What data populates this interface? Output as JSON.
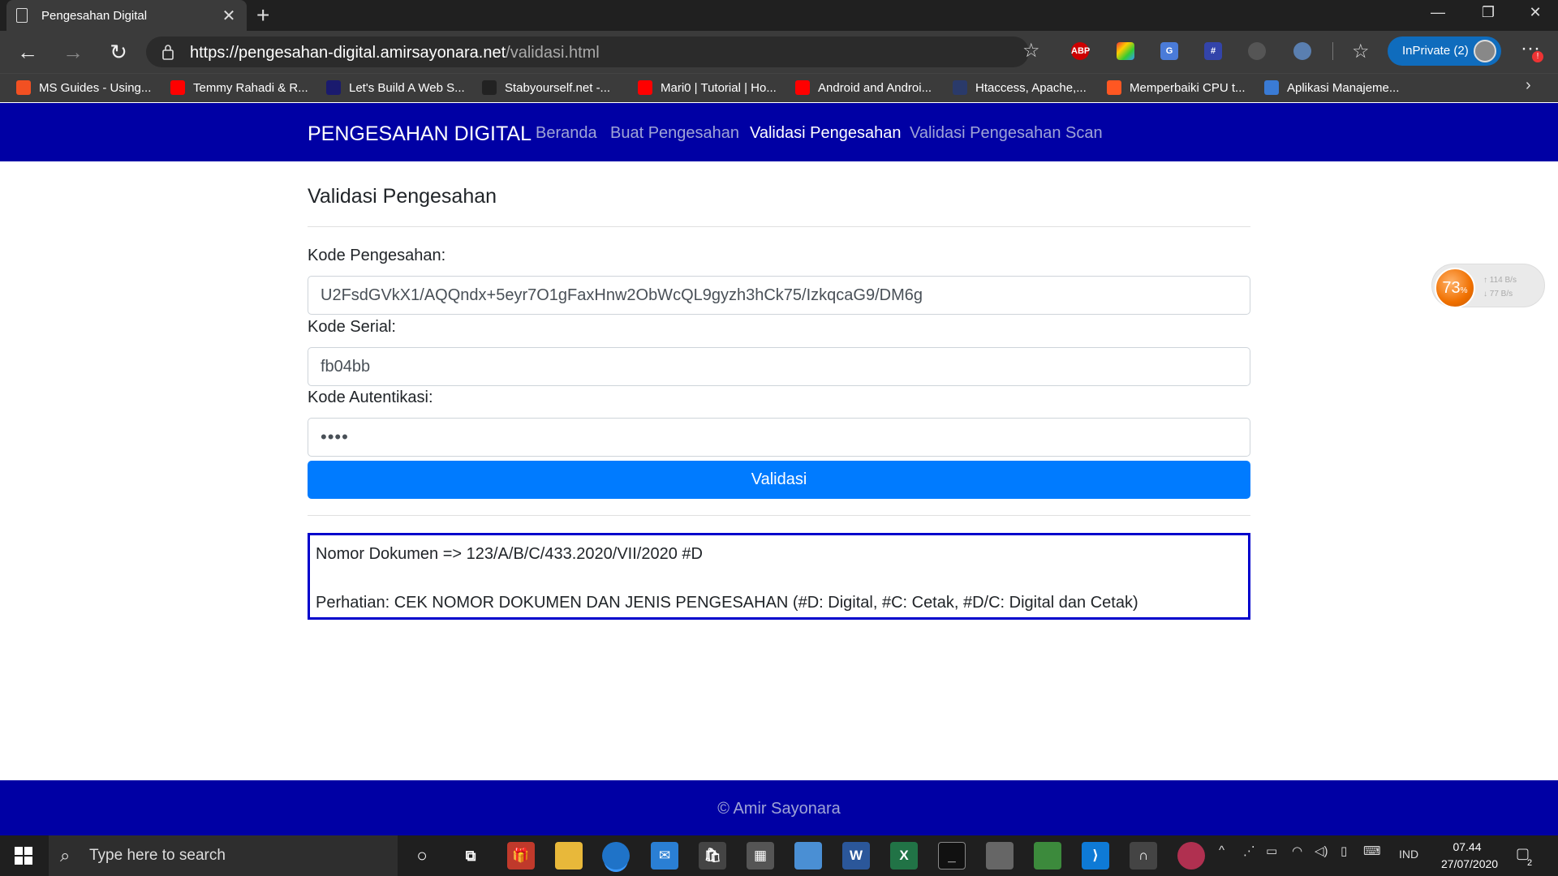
{
  "browser": {
    "tab_title": "Pengesahan Digital",
    "url_host": "https://pengesahan-digital.amirsayonara.net",
    "url_path": "/validasi.html",
    "inprivate_label": "InPrivate (2)",
    "extensions": [
      "abp-icon",
      "colorful-extension-icon",
      "google-translate-icon",
      "tech-extension-icon",
      "bot-icon",
      "globe-icon"
    ]
  },
  "bookmarks": [
    {
      "label": "MS Guides - Using...",
      "icon": "microsoft-icon",
      "color": "#f25022"
    },
    {
      "label": "Temmy Rahadi & R...",
      "icon": "youtube-icon",
      "color": "#ff0000"
    },
    {
      "label": "Let's Build A Web S...",
      "icon": "rs-icon",
      "color": "#1a1a6e"
    },
    {
      "label": "Stabyourself.net -...",
      "icon": "m-icon",
      "color": "#222222"
    },
    {
      "label": "Mari0 | Tutorial | Ho...",
      "icon": "youtube-icon",
      "color": "#ff0000"
    },
    {
      "label": "Android and Androi...",
      "icon": "youtube-icon",
      "color": "#ff0000"
    },
    {
      "label": "Htaccess, Apache,...",
      "icon": "site-icon",
      "color": "#2a3a6a"
    },
    {
      "label": "Memperbaiki CPU t...",
      "icon": "blogger-icon",
      "color": "#ff5722"
    },
    {
      "label": "Aplikasi Manajeme...",
      "icon": "app-icon",
      "color": "#3a7bd5"
    }
  ],
  "site": {
    "brand": "PENGESAHAN DIGITAL",
    "nav": [
      "Beranda",
      "Buat Pengesahan",
      "Validasi Pengesahan",
      "Validasi Pengesahan Scan"
    ],
    "active_nav": "Validasi Pengesahan",
    "heading": "Validasi Pengesahan",
    "fields": {
      "kode_pengesahan_label": "Kode Pengesahan:",
      "kode_pengesahan_value": "U2FsdGVkX1/AQQndx+5eyr7O1gFaxHnw2ObWcQL9gyzh3hCk75/IzkqcaG9/DM6g",
      "kode_serial_label": "Kode Serial:",
      "kode_serial_value": "fb04bb",
      "kode_autentikasi_label": "Kode Autentikasi:",
      "kode_autentikasi_value": "••••"
    },
    "submit_label": "Validasi",
    "result": {
      "line1": "Nomor Dokumen => 123/A/B/C/433.2020/VII/2020 #D",
      "line2": "Perhatian: CEK NOMOR DOKUMEN DAN JENIS PENGESAHAN (#D: Digital, #C: Cetak, #D/C: Digital dan Cetak)"
    },
    "footer": "© Amir Sayonara"
  },
  "widget": {
    "percent": "73",
    "percent_unit": "%",
    "up": "114 B/s",
    "down": "77 B/s"
  },
  "taskbar": {
    "search_placeholder": "Type here to search",
    "language": "IND",
    "time": "07.44",
    "date": "27/07/2020",
    "notification_count": "2"
  },
  "colors": {
    "navbar": "#0000a4",
    "button": "#007bff",
    "result_border": "#0000cc"
  }
}
